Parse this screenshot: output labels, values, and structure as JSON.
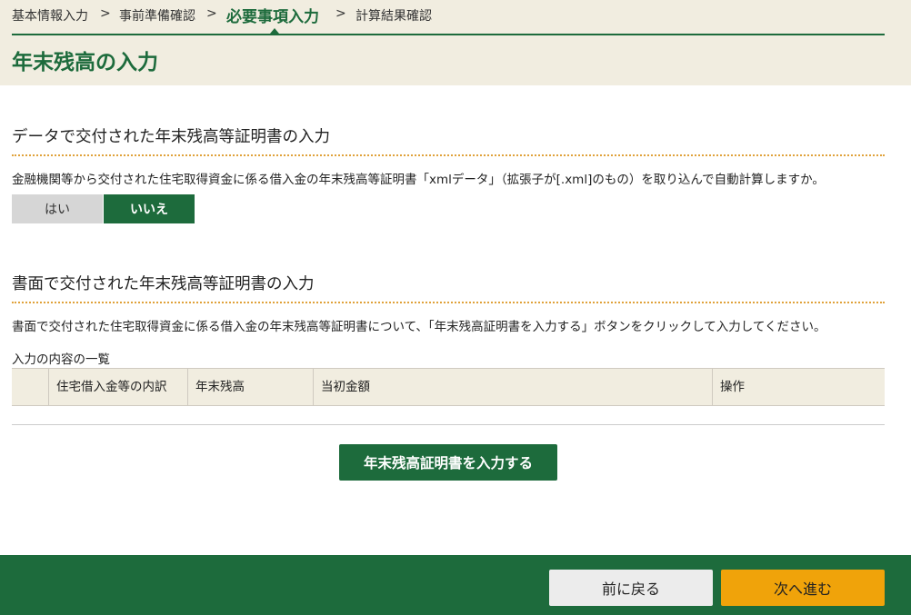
{
  "breadcrumb": {
    "steps": [
      "基本情報入力",
      "事前準備確認",
      "必要事項入力",
      "計算結果確認"
    ],
    "separator": ">",
    "current_index": 2
  },
  "page_title": "年末残高の入力",
  "data_section": {
    "heading": "データで交付された年末残高等証明書の入力",
    "question": "金融機関等から交付された住宅取得資金に係る借入金の年末残高等証明書「xmlデータ」（拡張子が[.xml]のもの）を取り込んで自動計算しますか。",
    "yes_label": "はい",
    "no_label": "いいえ",
    "selected": "いいえ"
  },
  "paper_section": {
    "heading": "書面で交付された年末残高等証明書の入力",
    "description": "書面で交付された住宅取得資金に係る借入金の年末残高等証明書について、「年末残高証明書を入力する」ボタンをクリックして入力してください。",
    "list_label": "入力の内容の一覧",
    "columns": [
      "",
      "住宅借入金等の内訳",
      "年末残高",
      "当初金額",
      "操作"
    ],
    "rows": [],
    "input_button": "年末残高証明書を入力する"
  },
  "footer": {
    "back_label": "前に戻る",
    "next_label": "次へ進む"
  },
  "colors": {
    "brand_green": "#1d6b3c",
    "header_bg": "#f1ede0",
    "accent_orange": "#f0a30a",
    "dotted_rule": "#e0a23a"
  }
}
